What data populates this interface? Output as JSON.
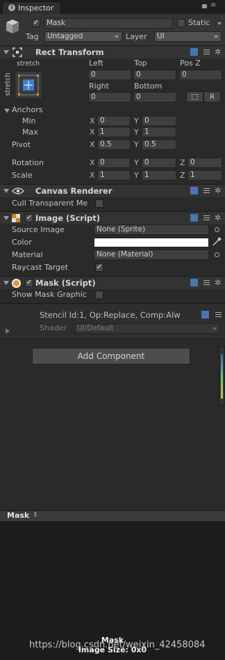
{
  "tab": {
    "label": "Inspector"
  },
  "object": {
    "name": "Mask",
    "static_label": "Static",
    "tag_label": "Tag",
    "tag_value": "Untagged",
    "layer_label": "Layer",
    "layer_value": "UI"
  },
  "rect_transform": {
    "title": "Rect Transform",
    "stretch_top": "stretch",
    "stretch_side": "stretch",
    "left_label": "Left",
    "left_value": "0",
    "top_label": "Top",
    "top_value": "0",
    "posz_label": "Pos Z",
    "posz_value": "0",
    "right_label": "Right",
    "right_value": "0",
    "bottom_label": "Bottom",
    "bottom_value": "0",
    "r_button": "R",
    "anchors_label": "Anchors",
    "min_label": "Min",
    "min_x": "0",
    "min_y": "0",
    "max_label": "Max",
    "max_x": "1",
    "max_y": "1",
    "pivot_label": "Pivot",
    "pivot_x": "0.5",
    "pivot_y": "0.5",
    "rotation_label": "Rotation",
    "rot_x": "0",
    "rot_y": "0",
    "rot_z": "0",
    "scale_label": "Scale",
    "scale_x": "1",
    "scale_y": "1",
    "scale_z": "1",
    "axis_x": "X",
    "axis_y": "Y",
    "axis_z": "Z"
  },
  "canvas_renderer": {
    "title": "Canvas Renderer",
    "cull_label": "Cull Transparent Me"
  },
  "image_script": {
    "title": "Image (Script)",
    "source_label": "Source Image",
    "source_value": "None (Sprite)",
    "color_label": "Color",
    "color_value": "#ffffff",
    "material_label": "Material",
    "material_value": "None (Material)",
    "raycast_label": "Raycast Target"
  },
  "mask_script": {
    "title": "Mask (Script)",
    "show_graphic_label": "Show Mask Graphic"
  },
  "stencil": {
    "title": "Stencil Id:1, Op:Replace, Comp:Alw",
    "shader_label": "Shader",
    "shader_value": "UI/Default"
  },
  "add_component_label": "Add Component",
  "preview": {
    "tab_label": "Mask",
    "name": "Mask",
    "size_text": "Image Size: 0x0"
  },
  "watermark": "https://blog.csdn.net/weixin_42458084",
  "colors": {
    "accent_blue": "#4a76b0",
    "panel": "#2a2a2a",
    "field": "#3f3f3f",
    "header": "#383838"
  }
}
